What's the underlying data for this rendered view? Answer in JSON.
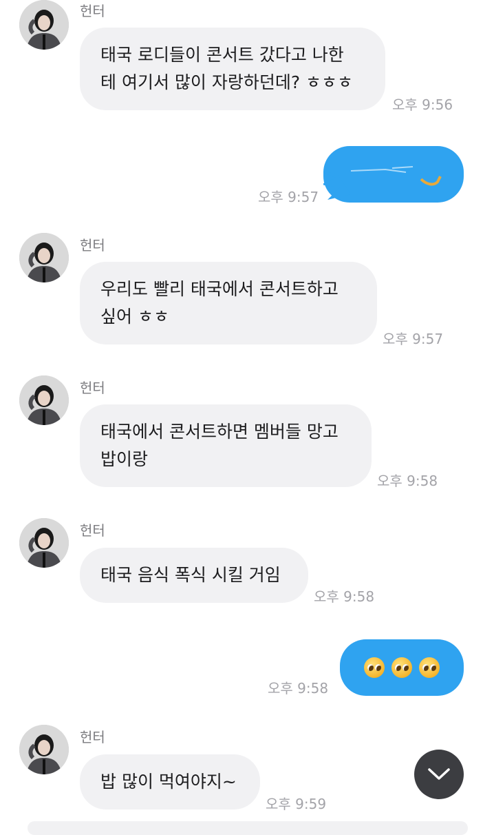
{
  "messages": [
    {
      "sender": "헌터",
      "text_lines": [
        "태국 로디들이 콘서트 갔다고 나한",
        "테 여기서 많이 자랑하던데? ㅎㅎㅎ"
      ],
      "time": "오후 9:56"
    },
    {
      "outgoing_time": "오후 9:57"
    },
    {
      "sender": "헌터",
      "text_lines": [
        "우리도 빨리 태국에서 콘서트하고",
        "싶어 ㅎㅎ"
      ],
      "time": "오후 9:57"
    },
    {
      "sender": "헌터",
      "text_lines": [
        "태국에서 콘서트하면 멤버들 망고",
        "밥이랑"
      ],
      "time": "오후 9:58"
    },
    {
      "sender": "헌터",
      "text_lines": [
        "태국 음식 폭식 시킬 거임"
      ],
      "time": "오후 9:58"
    },
    {
      "outgoing_time": "오후 9:58",
      "emojis": "🥺🥺🥺"
    },
    {
      "sender": "헌터",
      "text_lines": [
        "밥 많이 먹여야지~"
      ],
      "time": "오후 9:59"
    }
  ],
  "colors": {
    "incoming_bubble": "#f1f1f3",
    "outgoing_bubble": "#2fa3f0",
    "timestamp": "#a3a3a8"
  },
  "icons": {
    "scroll_down": "chevron-down-icon"
  }
}
